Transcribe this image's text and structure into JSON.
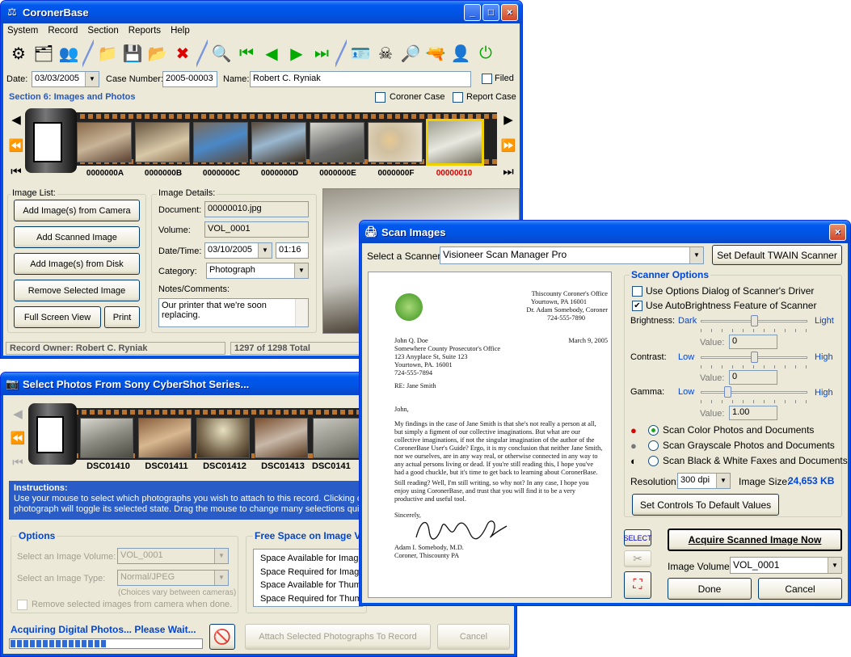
{
  "main_window": {
    "title": "CoronerBase",
    "menu": [
      "System",
      "Record",
      "Section",
      "Reports",
      "Help"
    ],
    "date_label": "Date:",
    "date_value": "03/03/2005",
    "case_number_label": "Case Number:",
    "case_number_value": "2005-00003",
    "name_label": "Name:",
    "name_value": "Robert C. Ryniak",
    "filed_label": "Filed",
    "section_title": "Section 6: Images and Photos",
    "coroner_case_label": "Coroner Case",
    "report_case_label": "Report Case",
    "frames": [
      "0000000A",
      "0000000B",
      "0000000C",
      "0000000D",
      "0000000E",
      "0000000F",
      "00000010"
    ],
    "image_list_label": "Image List:",
    "buttons": {
      "add_camera": "Add Image(s) from Camera",
      "add_scanned": "Add Scanned Image",
      "add_disk": "Add Image(s) from Disk",
      "remove": "Remove Selected Image",
      "full_screen": "Full Screen View",
      "print": "Print"
    },
    "image_details_label": "Image Details:",
    "document_label": "Document:",
    "document_value": "00000010.jpg",
    "volume_label": "Volume:",
    "volume_value": "VOL_0001",
    "datetime_label": "Date/Time:",
    "date2_value": "03/10/2005",
    "time_value": "01:16",
    "category_label": "Category:",
    "category_value": "Photograph",
    "notes_label": "Notes/Comments:",
    "notes_value": "Our printer that we're soon replacing.",
    "status_owner": "Record Owner: Robert C. Ryniak",
    "status_count": "1297 of 1298 Total"
  },
  "camera_window": {
    "title": "Select Photos From Sony CyberShot Series...",
    "frames": [
      "DSC01410",
      "DSC01411",
      "DSC01412",
      "DSC01413",
      "DSC0141"
    ],
    "instructions_title": "Instructions:",
    "instructions_line1": "Use your mouse to select which photographs you wish to attach to this record.  Clicking on",
    "instructions_line2": "photograph will toggle its selected state.  Drag the mouse to change many selections quick",
    "options_label": "Options",
    "volume_label": "Select an Image Volume:",
    "volume_value": "VOL_0001",
    "type_label": "Select an Image Type:",
    "type_value": "Normal/JPEG",
    "choices_note": "(Choices vary between cameras)",
    "remove_label": "Remove selected images from camera when done.",
    "free_space_label": "Free Space on Image V",
    "space_lines": [
      "Space Available for Image",
      "Space Required for Image",
      "Space Available for Thum",
      "Space Required for Thum"
    ],
    "acquiring": "Acquiring Digital Photos... Please Wait...",
    "attach_btn": "Attach Selected Photographs To Record",
    "cancel_btn": "Cancel",
    "progress": 0.5
  },
  "scan_window": {
    "title": "Scan Images",
    "scanner_label": "Select a Scanner:",
    "scanner_value": "Visioneer Scan Manager Pro",
    "set_default_btn": "Set Default TWAIN Scanner",
    "options_label": "Scanner Options",
    "opt1": "Use Options Dialog of Scanner's Driver",
    "opt2": "Use AutoBrightness Feature of Scanner",
    "brightness_label": "Brightness:",
    "brightness_low": "Dark",
    "brightness_high": "Light",
    "contrast_label": "Contrast:",
    "contrast_low": "Low",
    "contrast_high": "High",
    "gamma_label": "Gamma:",
    "gamma_low": "Low",
    "gamma_high": "High",
    "value_label": "Value:",
    "brightness_value": "0",
    "contrast_value": "0",
    "gamma_value": "1.00",
    "brightness_level": 0.5,
    "contrast_level": 0.5,
    "gamma_level": 0.25,
    "color_mode": "Scan Color Photos and Documents",
    "gray_mode": "Scan Grayscale Photos and Documents",
    "bw_mode": "Scan Black & White Faxes and Documents",
    "resolution_label": "Resolution:",
    "resolution_value": "300 dpi",
    "image_size_label": "Image Size:",
    "image_size_value": "24,653 KB",
    "defaults_btn": "Set Controls To Default Values",
    "select_tool": "SELECT",
    "acquire_btn": "Acquire Scanned Image Now",
    "volume_label": "Image Volume:",
    "volume_value": "VOL_0001",
    "done_btn": "Done",
    "cancel_btn": "Cancel",
    "letter": {
      "org": "Thiscounty Coroner's Office",
      "org_addr": "Yourtown, PA  16001",
      "org_person": "Dr. Adam Somebody, Coroner",
      "org_phone": "724-555-7890",
      "date": "March 9, 2005",
      "to1": "John Q. Doe",
      "to2": "Somewhere County Prosecutor's Office",
      "to3": "123 Anyplace St, Suite 123",
      "to4": "Yourtown, PA.  16001",
      "to5": "724-555-7894",
      "re": "RE: Jane Smith",
      "salutation": "John,",
      "p1": "My findings in the case of Jane Smith is that she's not really a person at all, but simply a figment of our collective imaginations.  But what are our collective imaginations, if not the singular imagination of the author of the CoronerBase User's Guide?  Ergo, it is my conclusion that neither Jane Smith, nor we ourselves, are in any way real, or otherwise connected in any way to any actual persons living or dead.  If you're still reading this, I hope you've had a good chuckle, but it's time to get back to learning about CoronerBase.",
      "p2": "Still reading?  Well, I'm still writing, so why not?  In any case, I hope you enjoy using CoronerBase, and trust that you will find it to be a very productive and useful tool.",
      "closing": "Sincerely,",
      "sig1": "Adam I. Somebody, M.D.",
      "sig2": "Coroner, Thiscounty PA"
    }
  }
}
